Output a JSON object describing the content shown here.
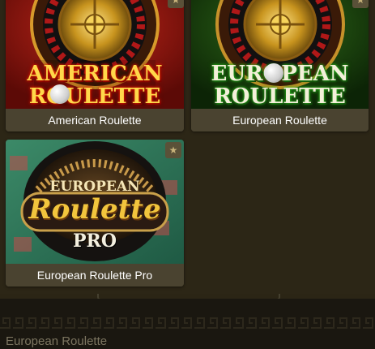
{
  "games": [
    {
      "title": "American Roulette",
      "logo_line1": "AMERICAN",
      "logo_line2": "ROULETTE"
    },
    {
      "title": "European Roulette",
      "logo_line1": "EUROPEAN",
      "logo_line2": "ROULETTE"
    },
    {
      "title": "European Roulette Pro",
      "logo_line1": "EUROPEAN",
      "logo_line2": "Roulette",
      "logo_line3": "PRO"
    }
  ],
  "footer": {
    "title": "European Roulette"
  },
  "colors": {
    "accent_gold": "#f2c53d",
    "card_bg": "#4a4330",
    "page_bg": "#2c2616"
  },
  "icons": {
    "favorite": "star-icon"
  }
}
